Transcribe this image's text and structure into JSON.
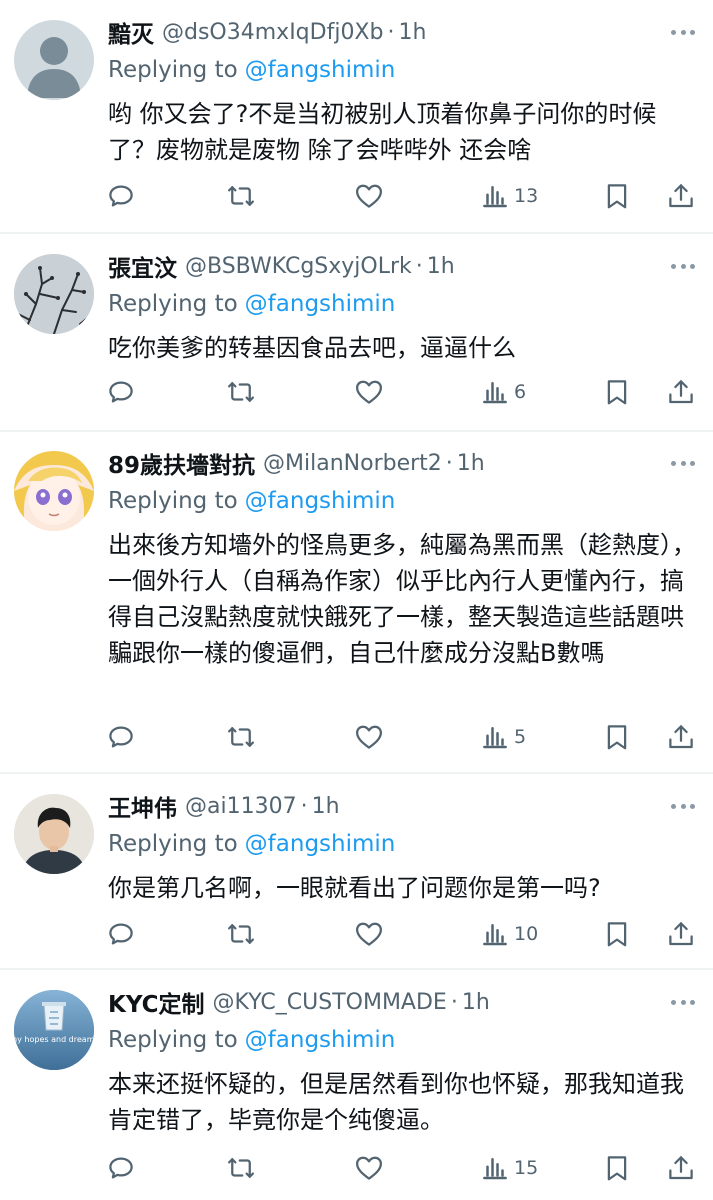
{
  "reply_prefix": "Replying to",
  "tweets": [
    {
      "name": "黯灭",
      "handle": "@dsO34mxIqDfj0Xb",
      "time": "1h",
      "reply_to": "@fangshimin",
      "text": "哟  你又会了?不是当初被别人顶着你鼻子问你的时候了？废物就是废物  除了会哔哔外  还会啥",
      "views": "13",
      "avatar": "default-silhouette"
    },
    {
      "name": "張宜汶",
      "handle": "@BSBWKCgSxyjOLrk",
      "time": "1h",
      "reply_to": "@fangshimin",
      "text": "吃你美爹的转基因食品去吧，逼逼什么",
      "views": "6",
      "avatar": "branches-photo"
    },
    {
      "name": "89歲扶墻對抗",
      "handle": "@MilanNorbert2",
      "time": "1h",
      "reply_to": "@fangshimin",
      "text": "出來後方知墻外的怪鳥更多，純屬為黑而黑（趁熱度），一個外行人（自稱為作家）似乎比內行人更懂內行，搞得自己沒點熱度就快餓死了一樣，整天製造這些話題哄騙跟你一樣的傻逼們，自己什麼成分沒點B數嗎",
      "views": "5",
      "avatar": "anime-girl"
    },
    {
      "name": "王坤伟",
      "handle": "@ai11307",
      "time": "1h",
      "reply_to": "@fangshimin",
      "text": "你是第几名啊，一眼就看出了问题你是第一吗?",
      "views": "10",
      "avatar": "person-photo"
    },
    {
      "name": "KYC定制",
      "handle": "@KYC_CUSTOMMADE",
      "time": "1h",
      "reply_to": "@fangshimin",
      "text": "本来还挺怀疑的，但是居然看到你也怀疑，那我知道我肯定错了，毕竟你是个纯傻逼。",
      "views": "15",
      "avatar": "recycle-bin",
      "avatar_text": "my hopes and dreams"
    }
  ]
}
